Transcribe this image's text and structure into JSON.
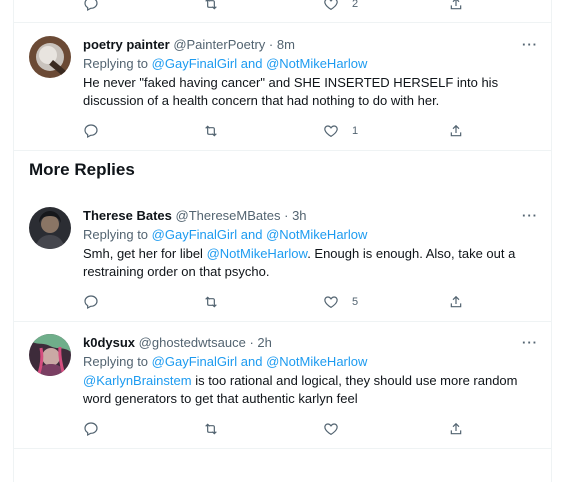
{
  "top_actions": {
    "like_count": "2"
  },
  "section": {
    "more_replies": "More Replies"
  },
  "tweets": [
    {
      "name": "poetry painter",
      "handle": "@PainterPoetry",
      "dot": "·",
      "time": "8m",
      "replying_prefix": "Replying to",
      "mention1": "@GayFinalGirl",
      "and": "and",
      "mention2": "@NotMikeHarlow",
      "text": "He never \"faked having cancer\" and SHE INSERTED HERSELF into his discussion of a health concern that had nothing to do with her.",
      "like_count": "1",
      "more": "···"
    },
    {
      "name": "Therese Bates",
      "handle": "@ThereseMBates",
      "dot": "·",
      "time": "3h",
      "replying_prefix": "Replying to",
      "mention1": "@GayFinalGirl",
      "and": "and",
      "mention2": "@NotMikeHarlow",
      "text_a": "Smh, get her for libel ",
      "text_link": "@NotMikeHarlow",
      "text_b": ". Enough is enough. Also, take out a restraining order on that psycho.",
      "like_count": "5",
      "more": "···"
    },
    {
      "name": "k0dysux",
      "handle": "@ghostedwtsauce",
      "dot": "·",
      "time": "2h",
      "replying_prefix": "Replying to",
      "mention1": "@GayFinalGirl",
      "and": "and",
      "mention2": "@NotMikeHarlow",
      "text_link": "@KarlynBrainstem",
      "text_b": " is too rational and logical, they should use more random word generators to get that authentic karlyn feel",
      "more": "···"
    }
  ],
  "icons": {
    "reply": "reply-icon",
    "retweet": "retweet-icon",
    "like": "heart-icon",
    "share": "share-icon",
    "more": "more-icon"
  },
  "colors": {
    "link": "#1d9bf0",
    "muted": "#536471",
    "text": "#0f1419",
    "border": "#eff3f4"
  }
}
